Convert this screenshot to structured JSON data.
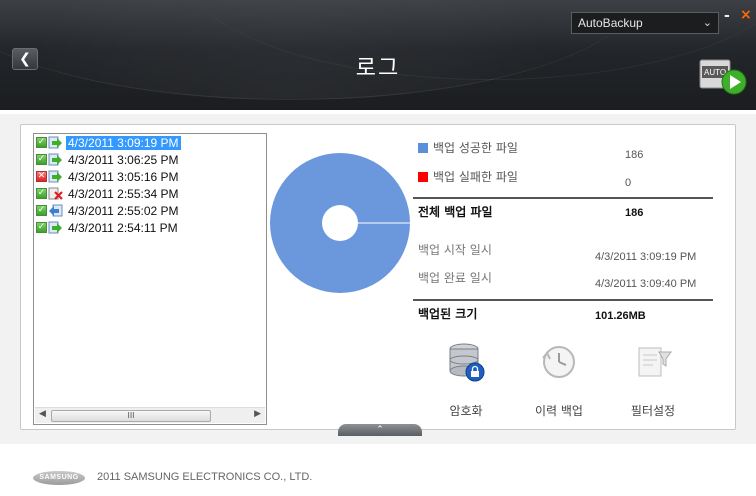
{
  "header": {
    "title": "로그",
    "app_select_value": "AutoBackup",
    "minimize": "-",
    "close": "×",
    "back_icon": "left-arrow-icon"
  },
  "log_list": {
    "items": [
      {
        "timestamp": "4/3/2011 3:09:19 PM",
        "checked": true,
        "status": "success",
        "selected": true
      },
      {
        "timestamp": "4/3/2011 3:06:25 PM",
        "checked": true,
        "status": "success",
        "selected": false
      },
      {
        "timestamp": "4/3/2011 3:05:16 PM",
        "checked": false,
        "status": "success",
        "selected": false
      },
      {
        "timestamp": "4/3/2011 2:55:34 PM",
        "checked": true,
        "status": "failed",
        "selected": false
      },
      {
        "timestamp": "4/3/2011 2:55:02 PM",
        "checked": true,
        "status": "restore",
        "selected": false
      },
      {
        "timestamp": "4/3/2011 2:54:11 PM",
        "checked": true,
        "status": "success",
        "selected": false
      }
    ],
    "scroll_thumb_label": "III"
  },
  "summary": {
    "success_label": "백업 성공한 파일",
    "success_value": "186",
    "failed_label": "백업 실패한 파일",
    "failed_value": "0",
    "total_label": "전체 백업 파일",
    "total_value": "186",
    "start_label": "백업 시작 일시",
    "start_value": "4/3/2011 3:09:19 PM",
    "end_label": "백업 완료 일시",
    "end_value": "4/3/2011 3:09:40 PM",
    "size_label": "백업된 크기",
    "size_value": "101.26MB",
    "colors": {
      "success": "#5b8fd9",
      "failed": "#ff0000"
    }
  },
  "chart_data": {
    "type": "pie",
    "categories": [
      "백업 성공한 파일",
      "백업 실패한 파일"
    ],
    "values": [
      186,
      0
    ],
    "colors": [
      "#6b98dd",
      "#ff0000"
    ]
  },
  "actions": [
    {
      "label": "암호화",
      "icon": "database-lock-icon"
    },
    {
      "label": "이력 백업",
      "icon": "clock-history-icon"
    },
    {
      "label": "필터설정",
      "icon": "document-filter-icon"
    }
  ],
  "collapse_icon": "chevron-up-icon",
  "footer": {
    "logo_text": "SAMSUNG",
    "copyright": "2011 SAMSUNG ELECTRONICS CO., LTD."
  }
}
